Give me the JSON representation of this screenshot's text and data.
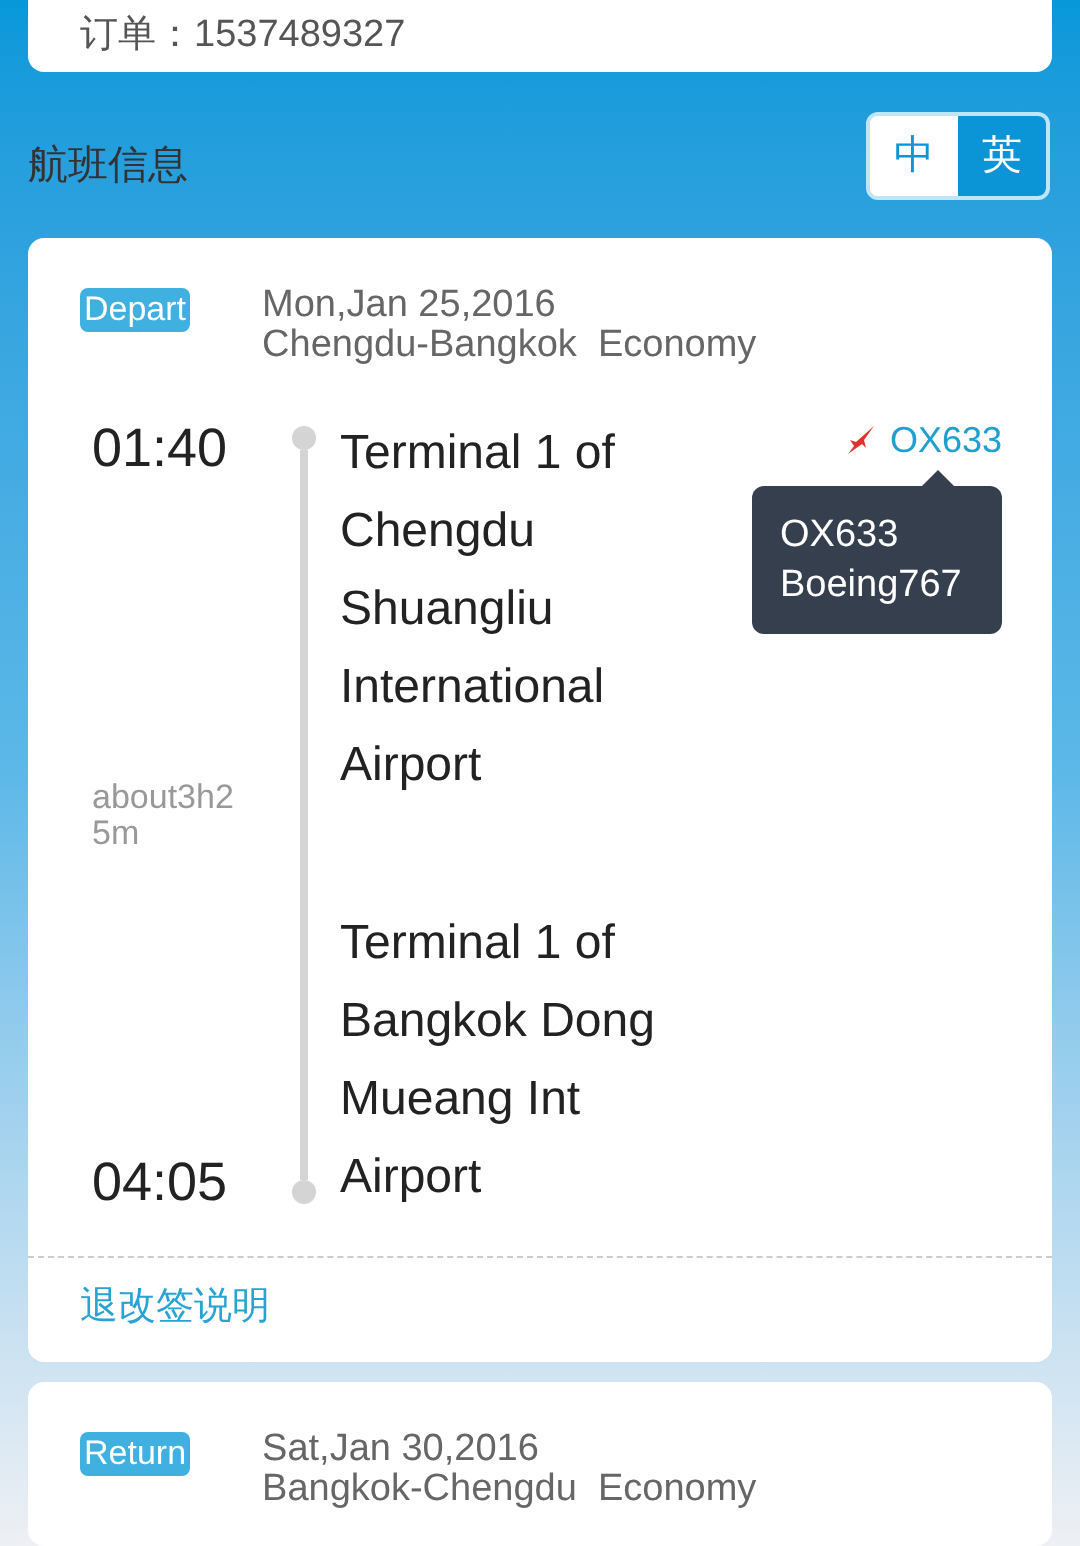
{
  "order": {
    "text": "订单：1537489327"
  },
  "section_title": "航班信息",
  "language_toggle": [
    {
      "label": "中",
      "selected": false
    },
    {
      "label": "英",
      "selected": true
    }
  ],
  "segments": [
    {
      "tag": "Depart",
      "date": "Mon,Jan 25,2016",
      "route_class": "Chengdu-Bangkok  Economy",
      "departure_time": "01:40",
      "departure_airport": "Terminal 1 of Chengdu Shuangliu International Airport",
      "duration": "about3h25m",
      "arrival_time": "04:05",
      "arrival_airport": "Terminal 1 of Bangkok Dong Mueang Int Airport",
      "flight_no": "OX633",
      "tooltip": [
        "OX633",
        "Boeing767"
      ],
      "change_rules": "退改签说明"
    },
    {
      "tag": "Return",
      "date": "Sat,Jan 30,2016",
      "route_class": "Bangkok-Chengdu  Economy"
    }
  ]
}
